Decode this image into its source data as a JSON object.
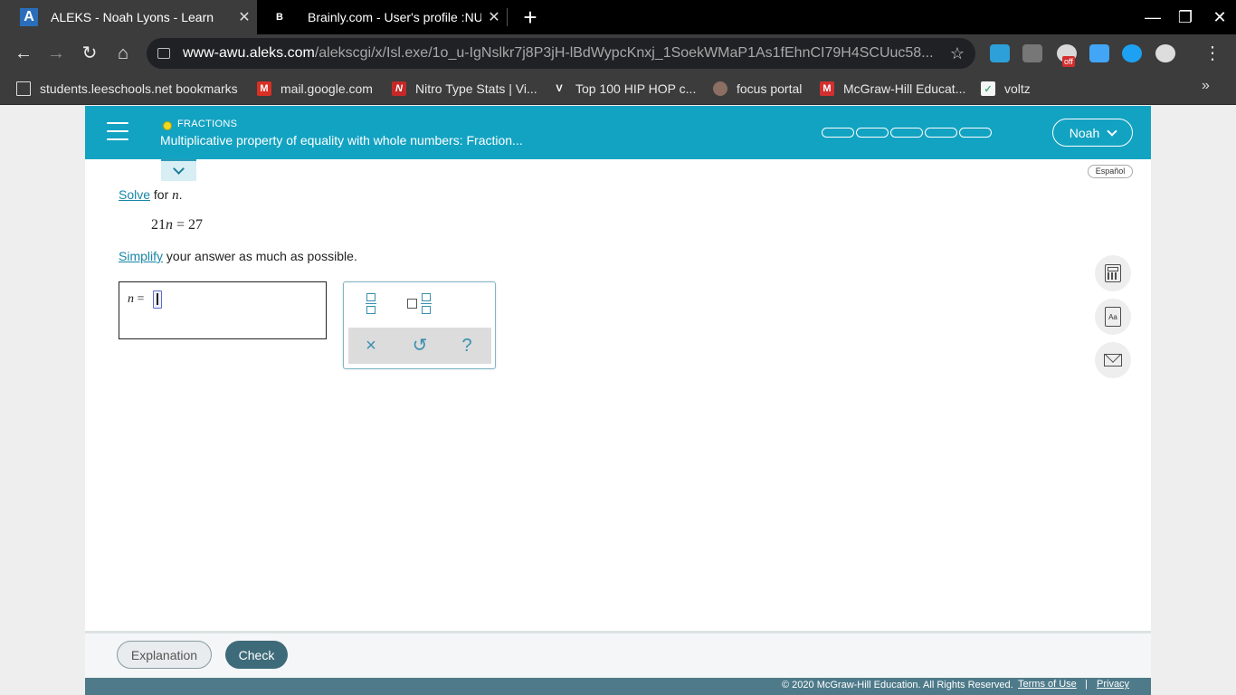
{
  "browser": {
    "tabs": [
      {
        "title": "ALEKS - Noah Lyons - Learn",
        "favicon": "A",
        "active": true
      },
      {
        "title": "Brainly.com - User's profile :NUMBER",
        "favicon": "B",
        "active": false
      }
    ],
    "address": {
      "domain": "www-awu.aleks.com",
      "path": "/alekscgi/x/Isl.exe/1o_u-IgNslkr7j8P3jH-lBdWypcKnxj_1SoekWMaP1As1fEhnCI79H4SCUuc58..."
    },
    "extension_badge": "off",
    "bookmarks": [
      {
        "label": "students.leeschools.net bookmarks",
        "icon": "folder-icon"
      },
      {
        "label": "mail.google.com",
        "icon": "gmail-icon"
      },
      {
        "label": "Nitro Type Stats | Vi...",
        "icon": "nitro-icon"
      },
      {
        "label": "Top 100 HIP HOP c...",
        "icon": "v-icon"
      },
      {
        "label": "focus portal",
        "icon": "focus-icon"
      },
      {
        "label": "McGraw-Hill Educat...",
        "icon": "mcgraw-icon"
      },
      {
        "label": "voltz",
        "icon": "voltz-icon"
      }
    ]
  },
  "header": {
    "topic_label": "FRACTIONS",
    "topic_title": "Multiplicative property of equality with whole numbers: Fraction...",
    "user_name": "Noah",
    "progress_segments": 5,
    "colors": {
      "header_bg": "#13a3c2",
      "topic_dot": "#f0d722"
    }
  },
  "language_button": "Español",
  "question": {
    "line1_link": "Solve",
    "line1_text": " for ",
    "line1_var": "n",
    "line1_end": ".",
    "eq_left": "21",
    "eq_var": "n",
    "eq_right": " = 27",
    "line3_link": "Simplify",
    "line3_text": " your answer as much as possible."
  },
  "answer": {
    "var": "n",
    "equals": " =",
    "value": ""
  },
  "keypad": {
    "buttons": [
      "fraction-button",
      "mixed-number-button"
    ],
    "controls": {
      "clear": "×",
      "undo": "↺",
      "help": "?"
    }
  },
  "bottom": {
    "explanation_label": "Explanation",
    "check_label": "Check",
    "check_color": "#3e6b7a"
  },
  "footer": {
    "copyright": "© 2020 McGraw-Hill Education. All Rights Reserved.",
    "terms": "Terms of Use",
    "separator": "|",
    "privacy": "Privacy"
  }
}
